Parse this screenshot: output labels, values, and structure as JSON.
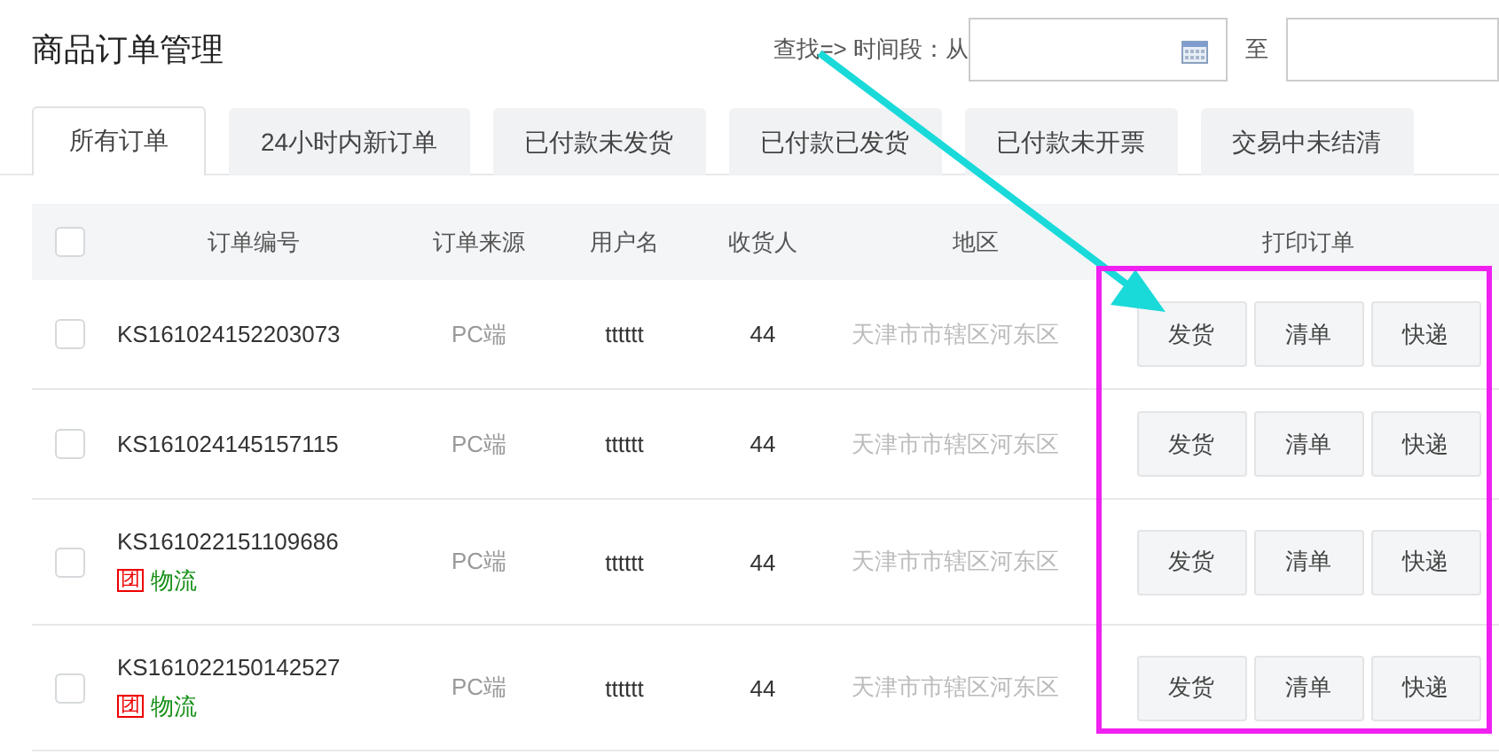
{
  "title": "商品订单管理",
  "search": {
    "label": "查找=> 时间段：从",
    "separator": "至"
  },
  "tabs": [
    {
      "label": "所有订单",
      "selected": true
    },
    {
      "label": "24小时内新订单",
      "selected": false
    },
    {
      "label": "已付款未发货",
      "selected": false
    },
    {
      "label": "已付款已发货",
      "selected": false
    },
    {
      "label": "已付款未开票",
      "selected": false
    },
    {
      "label": "交易中未结清",
      "selected": false
    }
  ],
  "table": {
    "columns": [
      "订单编号",
      "订单来源",
      "用户名",
      "收货人",
      "地区",
      "打印订单"
    ],
    "header_checked": false,
    "rows": [
      {
        "checked": false,
        "order_no": "KS161024152203073",
        "source": "PC端",
        "user": "tttttt",
        "receiver": "44",
        "region": "天津市市辖区河东区",
        "actions": [
          "发货",
          "清单",
          "快递"
        ]
      },
      {
        "checked": false,
        "order_no": "KS161024145157115",
        "source": "PC端",
        "user": "tttttt",
        "receiver": "44",
        "region": "天津市市辖区河东区",
        "actions": [
          "发货",
          "清单",
          "快递"
        ]
      },
      {
        "checked": false,
        "order_no": "KS161022151109686",
        "tag": {
          "icon": "团",
          "text": "物流"
        },
        "source": "PC端",
        "user": "tttttt",
        "receiver": "44",
        "region": "天津市市辖区河东区",
        "actions": [
          "发货",
          "清单",
          "快递"
        ]
      },
      {
        "checked": false,
        "order_no": "KS161022150142527",
        "tag": {
          "icon": "团",
          "text": "物流"
        },
        "source": "PC端",
        "user": "tttttt",
        "receiver": "44",
        "region": "天津市市辖区河东区",
        "actions": [
          "发货",
          "清单",
          "快递"
        ]
      }
    ]
  },
  "annotations": [
    {
      "kind": "arrow",
      "color": "#1ad9d9"
    },
    {
      "kind": "box",
      "color": "#f020f0"
    }
  ]
}
